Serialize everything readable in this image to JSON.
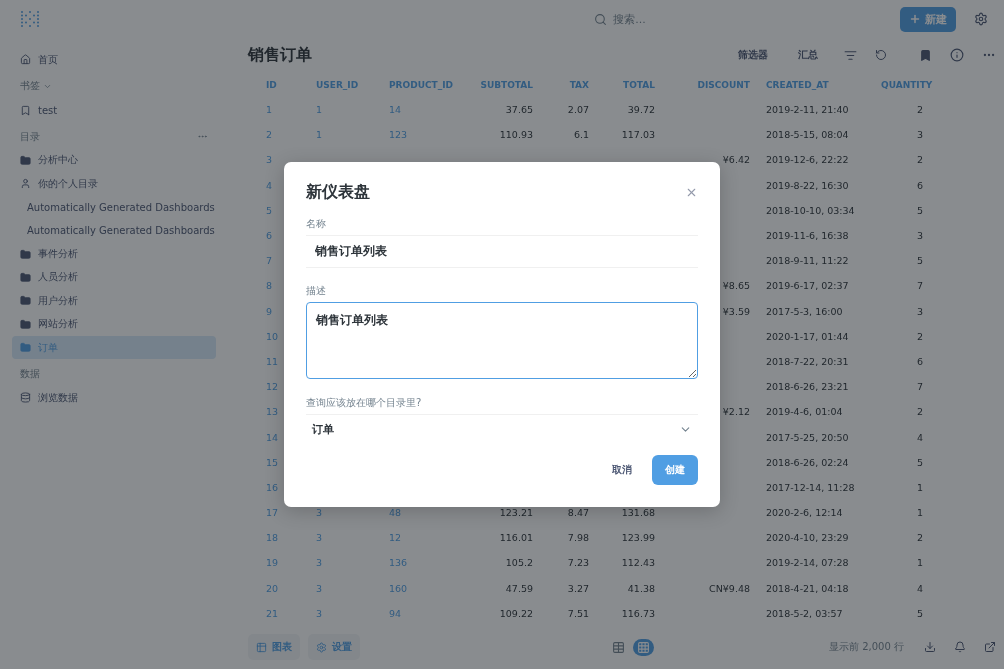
{
  "topbar": {
    "search": {
      "placeholder": "搜索..."
    },
    "new_button": "新建"
  },
  "sidebar": {
    "home": "首页",
    "bookmarks_heading": "书签",
    "bookmarks": [
      "test"
    ],
    "collections_heading": "目录",
    "collections": [
      {
        "label": "分析中心",
        "kind": "folder",
        "selected": false
      },
      {
        "label": "你的个人目录",
        "kind": "personal",
        "selected": false
      },
      {
        "label": "Automatically Generated Dashboards",
        "kind": "folder",
        "selected": false
      },
      {
        "label": "Automatically Generated Dashboards",
        "kind": "folder",
        "selected": false
      },
      {
        "label": "事件分析",
        "kind": "folder",
        "selected": false
      },
      {
        "label": "人员分析",
        "kind": "folder",
        "selected": false
      },
      {
        "label": "用户分析",
        "kind": "folder",
        "selected": false
      },
      {
        "label": "网站分析",
        "kind": "folder",
        "selected": false
      },
      {
        "label": "订单",
        "kind": "folder",
        "selected": true
      }
    ],
    "data_heading": "数据",
    "data_items": [
      "浏览数据"
    ]
  },
  "question": {
    "title": "销售订单",
    "actions": [
      "筛选器",
      "汇总"
    ]
  },
  "table": {
    "columns": [
      "ID",
      "USER_ID",
      "PRODUCT_ID",
      "SUBTOTAL",
      "TAX",
      "TOTAL",
      "DISCOUNT",
      "CREATED_AT",
      "QUANTITY"
    ],
    "rows": [
      [
        "1",
        "1",
        "14",
        "37.65",
        "2.07",
        "39.72",
        "",
        "2019-2-11, 21:40",
        "2"
      ],
      [
        "2",
        "1",
        "123",
        "110.93",
        "6.1",
        "117.03",
        "",
        "2018-5-15, 08:04",
        "3"
      ],
      [
        "3",
        "",
        "",
        "",
        "",
        "",
        "¥6.42",
        "2019-12-6, 22:22",
        "2"
      ],
      [
        "4",
        "",
        "",
        "",
        "",
        "",
        "",
        "2019-8-22, 16:30",
        "6"
      ],
      [
        "5",
        "",
        "",
        "",
        "",
        "",
        "",
        "2018-10-10, 03:34",
        "5"
      ],
      [
        "6",
        "",
        "",
        "",
        "",
        "",
        "",
        "2019-11-6, 16:38",
        "3"
      ],
      [
        "7",
        "",
        "",
        "",
        "",
        "",
        "",
        "2018-9-11, 11:22",
        "5"
      ],
      [
        "8",
        "",
        "",
        "",
        "",
        "",
        "¥8.65",
        "2019-6-17, 02:37",
        "7"
      ],
      [
        "9",
        "",
        "",
        "",
        "",
        "",
        "¥3.59",
        "2017-5-3, 16:00",
        "3"
      ],
      [
        "10",
        "",
        "",
        "",
        "",
        "",
        "",
        "2020-1-17, 01:44",
        "2"
      ],
      [
        "11",
        "",
        "",
        "",
        "",
        "",
        "",
        "2018-7-22, 20:31",
        "6"
      ],
      [
        "12",
        "",
        "",
        "",
        "",
        "",
        "",
        "2018-6-26, 23:21",
        "7"
      ],
      [
        "13",
        "",
        "",
        "",
        "",
        "",
        "¥2.12",
        "2019-4-6, 01:04",
        "2"
      ],
      [
        "14",
        "",
        "",
        "",
        "",
        "",
        "",
        "2017-5-25, 20:50",
        "4"
      ],
      [
        "15",
        "",
        "",
        "",
        "",
        "",
        "",
        "2018-6-26, 02:24",
        "5"
      ],
      [
        "16",
        "",
        "",
        "",
        "",
        "",
        "",
        "2017-12-14, 11:28",
        "1"
      ],
      [
        "17",
        "3",
        "48",
        "123.21",
        "8.47",
        "131.68",
        "",
        "2020-2-6, 12:14",
        "1"
      ],
      [
        "18",
        "3",
        "12",
        "116.01",
        "7.98",
        "123.99",
        "",
        "2020-4-10, 23:29",
        "2"
      ],
      [
        "19",
        "3",
        "136",
        "105.2",
        "7.23",
        "112.43",
        "",
        "2019-2-14, 07:28",
        "1"
      ],
      [
        "20",
        "3",
        "160",
        "47.59",
        "3.27",
        "41.38",
        "CN¥9.48",
        "2018-4-21, 04:18",
        "4"
      ],
      [
        "21",
        "3",
        "94",
        "109.22",
        "7.51",
        "116.73",
        "",
        "2018-5-2, 03:57",
        "5"
      ]
    ]
  },
  "footer": {
    "buttons": [
      "图表",
      "设置"
    ],
    "views": [
      {
        "kind": "table",
        "selected": false
      },
      {
        "kind": "grid",
        "selected": true
      }
    ],
    "row_count": "显示前 2,000 行"
  },
  "modal": {
    "title": "新仪表盘",
    "fields": [
      {
        "kind": "input",
        "label": "名称",
        "value": "销售订单列表"
      },
      {
        "kind": "textarea",
        "label": "描述",
        "value": "销售订单列表"
      },
      {
        "kind": "select",
        "label": "查询应该放在哪个目录里?",
        "value": "订单"
      }
    ],
    "cancel": "取消",
    "submit": "创建"
  }
}
